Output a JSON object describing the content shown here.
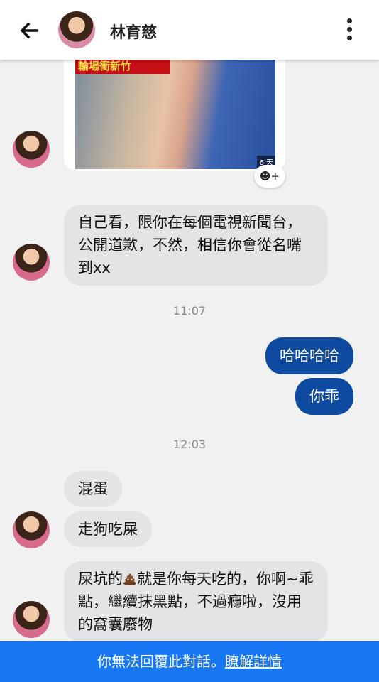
{
  "header": {
    "contact_name": "林育慈"
  },
  "photo": {
    "banner_text": "輪場衝新竹",
    "stamp": "6 天"
  },
  "messages": {
    "m1": "自己看，限你在每個電視新聞台，公開道歉，不然，相信你會從名嘴到xx",
    "time1": "11:07",
    "out1": "哈哈哈哈",
    "out2": "你乖",
    "time2": "12:03",
    "m2": "混蛋",
    "m3": "走狗吃屎",
    "m4_before": "屎坑的",
    "m4_after": "就是你每天吃的，你啊~乖點，繼續抹黑點，不過癮啦，沒用的窩囊廢物"
  },
  "footer": {
    "text": "你無法回覆此對話。",
    "link": "瞭解詳情"
  },
  "colors": {
    "outgoing_bubble": "#0e4aa0",
    "incoming_bubble": "#e4e4e6",
    "footer_bar": "#1877f2"
  },
  "icons": [
    "arrow-left-icon",
    "more-vertical-icon",
    "add-reaction-icon",
    "poop-emoji-icon"
  ]
}
